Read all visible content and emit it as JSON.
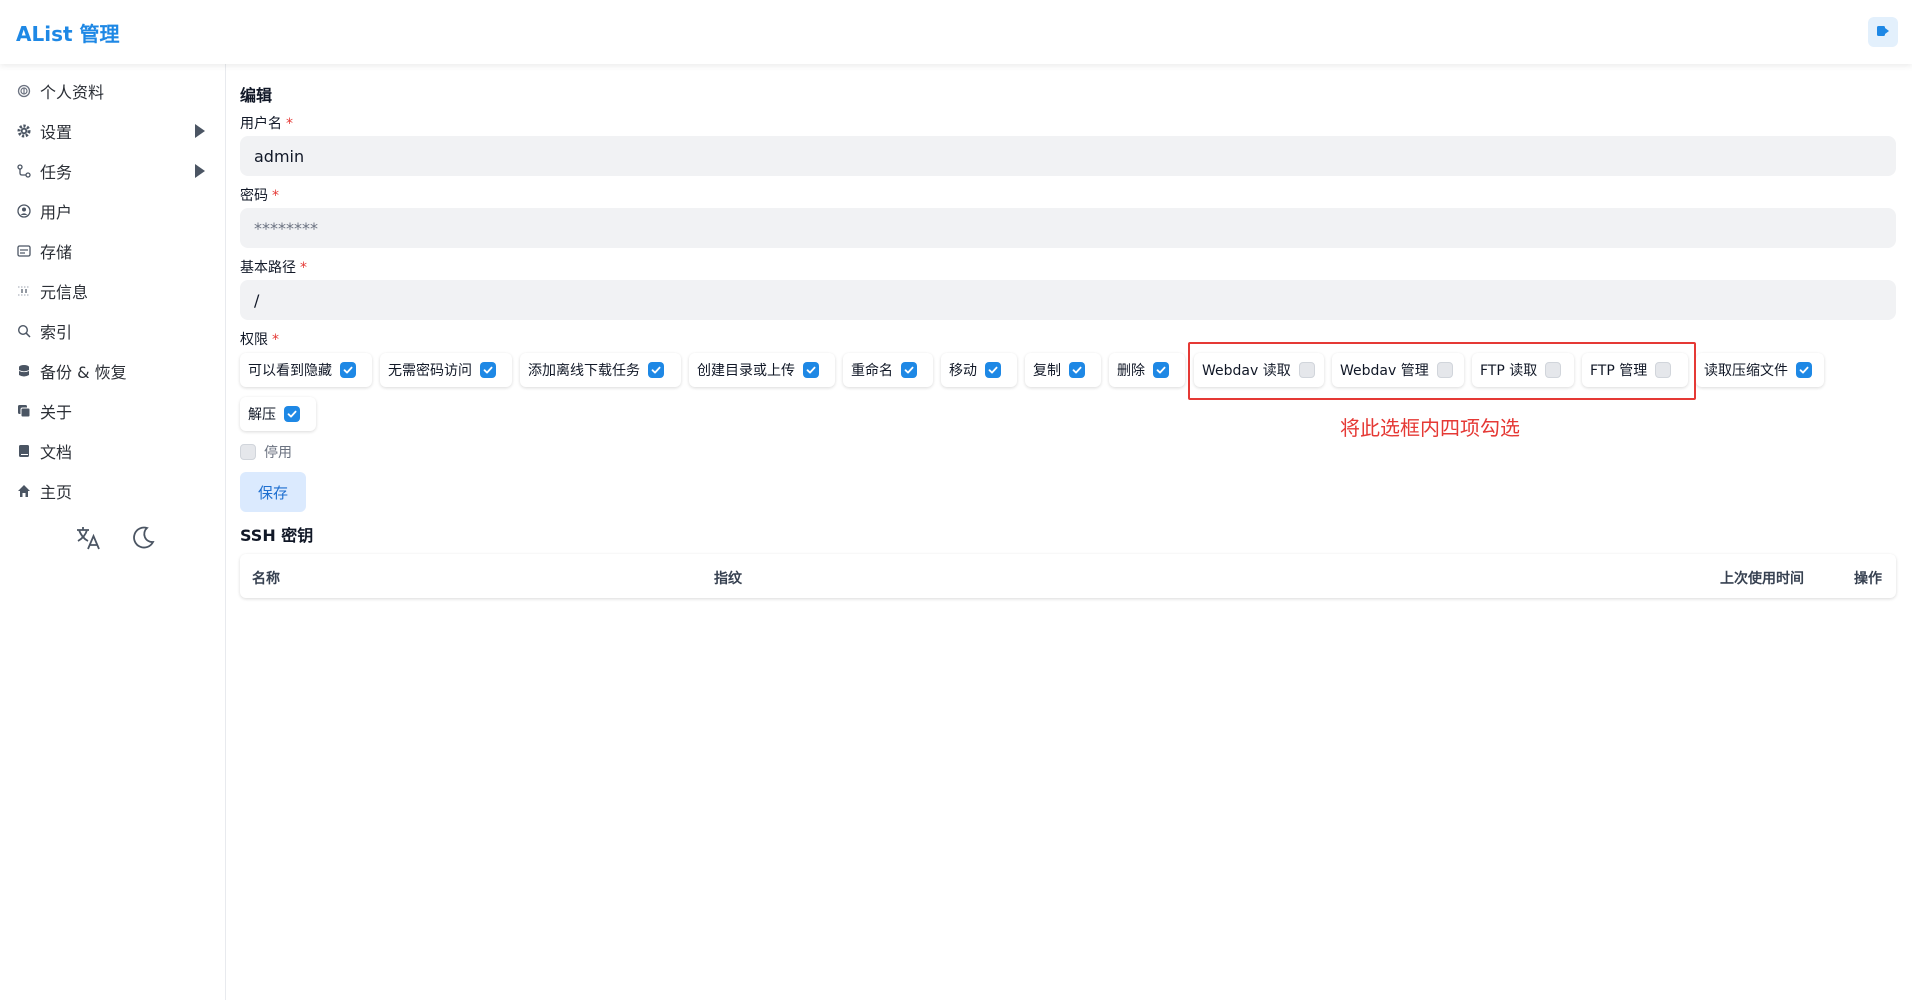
{
  "header": {
    "title": "AList 管理"
  },
  "sidebar": {
    "items": [
      {
        "label": "个人资料",
        "icon": "fingerprint-icon"
      },
      {
        "label": "设置",
        "icon": "gear-icon",
        "expandable": true
      },
      {
        "label": "任务",
        "icon": "task-flow-icon",
        "expandable": true
      },
      {
        "label": "用户",
        "icon": "user-circle-icon"
      },
      {
        "label": "存储",
        "icon": "storage-icon"
      },
      {
        "label": "元信息",
        "icon": "meta-icon"
      },
      {
        "label": "索引",
        "icon": "search-icon"
      },
      {
        "label": "备份 & 恢复",
        "icon": "database-icon"
      },
      {
        "label": "关于",
        "icon": "copy-icon"
      },
      {
        "label": "文档",
        "icon": "book-icon"
      },
      {
        "label": "主页",
        "icon": "home-icon"
      }
    ]
  },
  "form": {
    "section_title": "编辑",
    "username": {
      "label": "用户名",
      "required": "*",
      "value": "admin"
    },
    "password": {
      "label": "密码",
      "required": "*",
      "placeholder": "********"
    },
    "base_path": {
      "label": "基本路径",
      "required": "*",
      "value": "/"
    },
    "permissions": {
      "label": "权限",
      "required": "*",
      "items": [
        {
          "label": "可以看到隐藏",
          "checked": true
        },
        {
          "label": "无需密码访问",
          "checked": true
        },
        {
          "label": "添加离线下载任务",
          "checked": true
        },
        {
          "label": "创建目录或上传",
          "checked": true
        },
        {
          "label": "重命名",
          "checked": true
        },
        {
          "label": "移动",
          "checked": true
        },
        {
          "label": "复制",
          "checked": true
        },
        {
          "label": "删除",
          "checked": true
        },
        {
          "label": "Webdav 读取",
          "checked": false
        },
        {
          "label": "Webdav 管理",
          "checked": false
        },
        {
          "label": "FTP 读取",
          "checked": false
        },
        {
          "label": "FTP 管理",
          "checked": false
        },
        {
          "label": "读取压缩文件",
          "checked": true
        },
        {
          "label": "解压",
          "checked": true
        }
      ]
    },
    "annotation": "将此选框内四项勾选",
    "disable_label": "停用",
    "disable_checked": false,
    "save_label": "保存"
  },
  "ssh": {
    "title": "SSH 密钥",
    "columns": [
      "名称",
      "指纹",
      "上次使用时间",
      "操作"
    ]
  },
  "colors": {
    "accent": "#1e88e5",
    "annotation": "#e53935"
  }
}
